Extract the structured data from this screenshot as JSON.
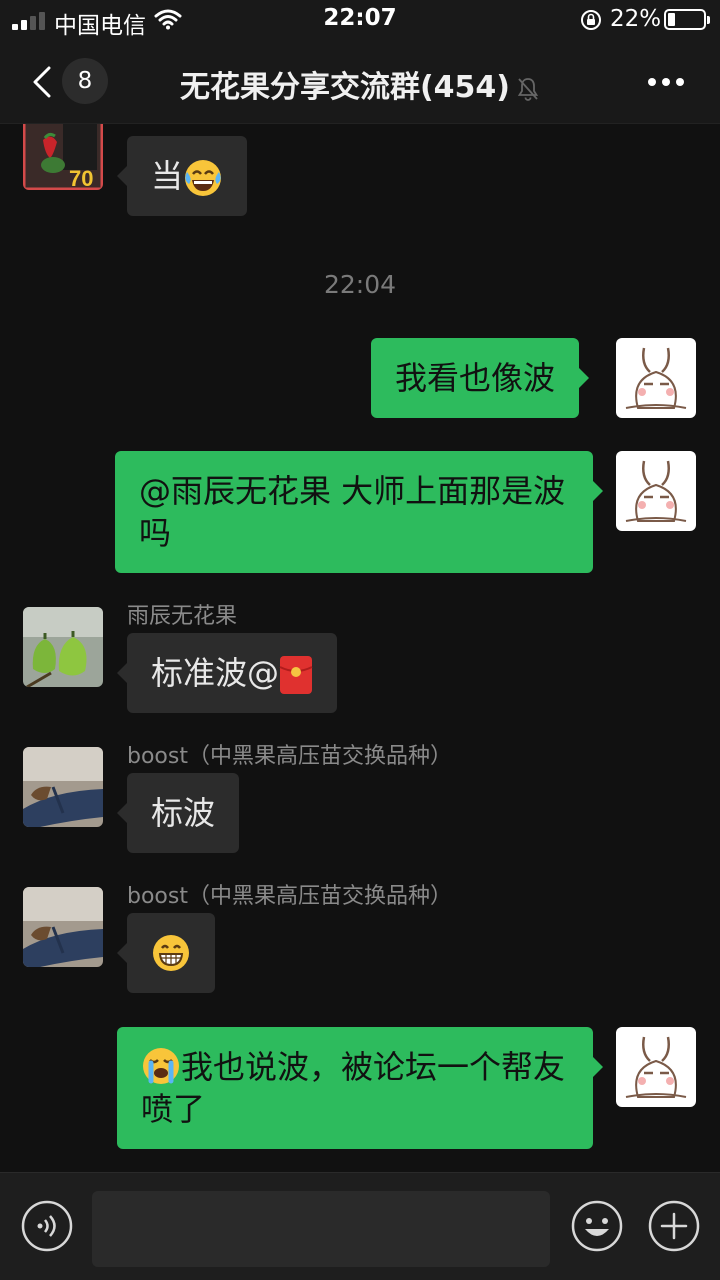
{
  "status_bar": {
    "carrier": "中国电信",
    "time": "22:07",
    "battery_percent": "22%",
    "battery_level": 0.22
  },
  "nav": {
    "unread_count": "8",
    "title": "无花果分享交流群(454)"
  },
  "chat": {
    "timestamp": "22:04",
    "messages": [
      {
        "direction": "in",
        "text": "当",
        "emoji": "face-with-tears-of-joy"
      },
      {
        "direction": "out",
        "text": "我看也像波"
      },
      {
        "direction": "out",
        "text": "@雨辰无花果 大师上面那是波吗"
      },
      {
        "direction": "in",
        "sender": "雨辰无花果",
        "text": "标准波@",
        "emoji": "red-envelope"
      },
      {
        "direction": "in",
        "sender": "boost（中黑果高压苗交换品种）",
        "text": "标波"
      },
      {
        "direction": "in",
        "sender": "boost（中黑果高压苗交换品种）",
        "text": "",
        "emoji": "grinning-face"
      },
      {
        "direction": "out",
        "text": "我也说波，被论坛一个帮友喷了",
        "emoji": "loudly-crying-face"
      }
    ]
  },
  "input": {
    "placeholder": ""
  },
  "colors": {
    "background": "#111111",
    "bar": "#191919",
    "bubble_in": "#2c2c2c",
    "bubble_out": "#2dbb5d"
  }
}
